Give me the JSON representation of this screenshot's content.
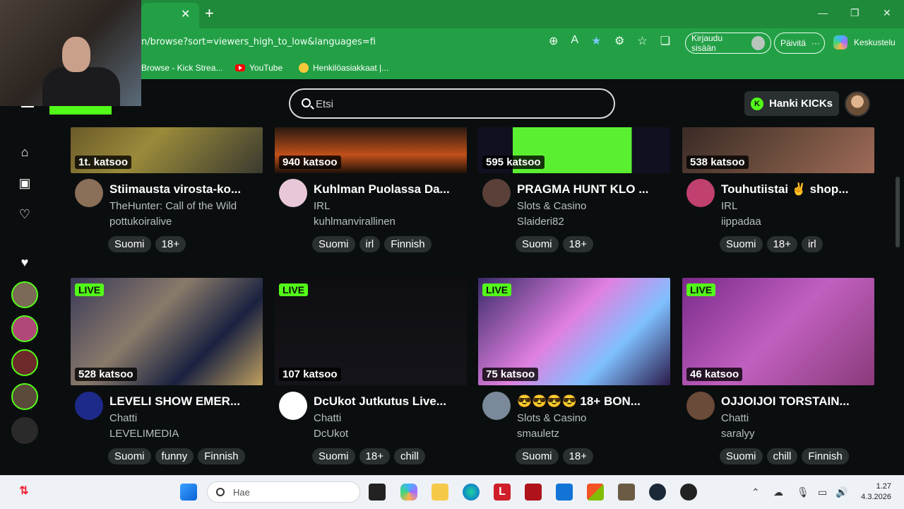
{
  "browser": {
    "url": "n/browse?sort=viewers_high_to_low&languages=fi",
    "login_label": "Kirjaudu sisään",
    "update_label": "Päivitä",
    "copilot_label": "Keskustelu",
    "bookmarks": [
      {
        "label": "Browse - Kick Strea...",
        "icon": "kick-icon"
      },
      {
        "label": "YouTube",
        "icon": "youtube-icon"
      },
      {
        "label": "Henkilöasiakkaat |...",
        "icon": "face-icon"
      }
    ]
  },
  "kick": {
    "search_placeholder": "Etsi",
    "kicks_button": "Hanki KICKs",
    "kicks_icon_letter": "K",
    "accent": "#53fc18",
    "live_label": "LIVE",
    "streams": [
      {
        "viewers": "1t. katsoo",
        "title": "Stiimausta virosta-ko...",
        "category": "TheHunter: Call of the Wild",
        "channel": "pottukoiralive",
        "tags": [
          "Suomi",
          "18+"
        ],
        "live": false
      },
      {
        "viewers": "940 katsoo",
        "title": "Kuhlman Puolassa Da...",
        "category": "IRL",
        "channel": "kuhlmanvirallinen",
        "tags": [
          "Suomi",
          "irl",
          "Finnish"
        ],
        "live": false
      },
      {
        "viewers": "595 katsoo",
        "title": "PRAGMA HUNT KLO ...",
        "category": "Slots & Casino",
        "channel": "Slaideri82",
        "tags": [
          "Suomi",
          "18+"
        ],
        "live": false
      },
      {
        "viewers": "538 katsoo",
        "title": "Touhutiistai ✌️ shop...",
        "category": "IRL",
        "channel": "iippadaa",
        "tags": [
          "Suomi",
          "18+",
          "irl"
        ],
        "live": false
      },
      {
        "viewers": "528 katsoo",
        "title": "LEVELI SHOW EMER...",
        "category": "Chatti",
        "channel": "LEVELIMEDIA",
        "tags": [
          "Suomi",
          "funny",
          "Finnish"
        ],
        "live": true
      },
      {
        "viewers": "107 katsoo",
        "title": "DcUkot Jutkutus Live...",
        "category": "Chatti",
        "channel": "DcUkot",
        "tags": [
          "Suomi",
          "18+",
          "chill"
        ],
        "live": true
      },
      {
        "viewers": "75 katsoo",
        "title": "😎😎😎😎 18+ BON...",
        "category": "Slots & Casino",
        "channel": "smauletz",
        "tags": [
          "Suomi",
          "18+"
        ],
        "live": true
      },
      {
        "viewers": "46 katsoo",
        "title": "OJJOIJOI TORSTAIN...",
        "category": "Chatti",
        "channel": "saralyy",
        "tags": [
          "Suomi",
          "chill",
          "Finnish"
        ],
        "live": true
      }
    ]
  },
  "taskbar": {
    "search_placeholder": "Hae",
    "time": "1.27",
    "date": "4.3.2026"
  }
}
